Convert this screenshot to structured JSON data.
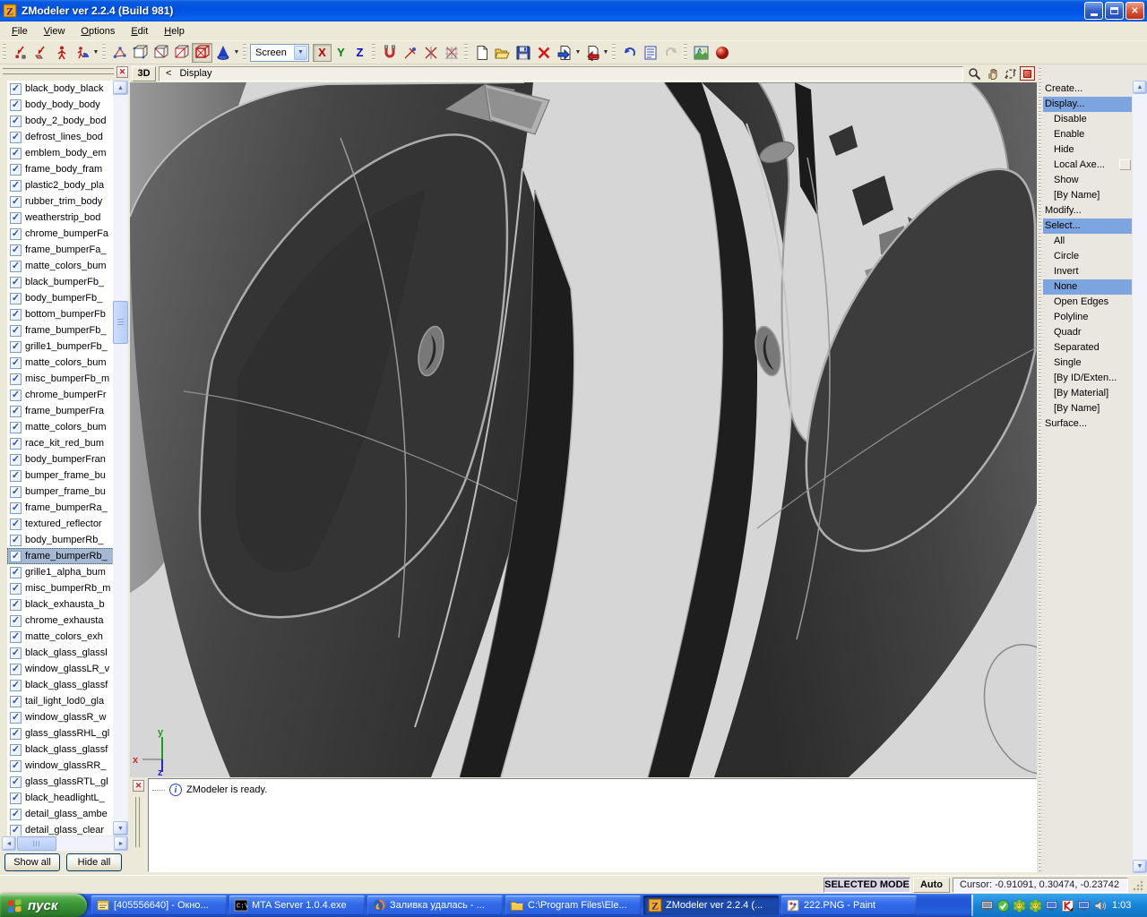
{
  "window": {
    "title": "ZModeler ver 2.2.4 (Build 981)"
  },
  "menu": [
    "File",
    "View",
    "Options",
    "Edit",
    "Help"
  ],
  "toolbar": {
    "screen_combo": "Screen",
    "axis_x": "X",
    "axis_y": "Y",
    "axis_z": "Z"
  },
  "viewport": {
    "mode": "3D",
    "back": "<",
    "path": "Display",
    "axis": {
      "x": "x",
      "y": "y",
      "z": "z"
    }
  },
  "left_panel": {
    "selected_index": 29,
    "items": [
      "black_body_black",
      "body_body_body",
      "body_2_body_bod",
      "defrost_lines_bod",
      "emblem_body_em",
      "frame_body_fram",
      "plastic2_body_pla",
      "rubber_trim_body",
      "weatherstrip_bod",
      "chrome_bumperFa",
      "frame_bumperFa_",
      "matte_colors_bum",
      "black_bumperFb_",
      "body_bumperFb_",
      "bottom_bumperFb",
      "frame_bumperFb_",
      "grille1_bumperFb_",
      "matte_colors_bum",
      "misc_bumperFb_m",
      "chrome_bumperFr",
      "frame_bumperFra",
      "matte_colors_bum",
      "race_kit_red_bum",
      "body_bumperFran",
      "bumper_frame_bu",
      "bumper_frame_bu",
      "frame_bumperRa_",
      "textured_reflector",
      "body_bumperRb_",
      "frame_bumperRb_",
      "grille1_alpha_bum",
      "misc_bumperRb_m",
      "black_exhausta_b",
      "chrome_exhausta",
      "matte_colors_exh",
      "black_glass_glassl",
      "window_glassLR_v",
      "black_glass_glassf",
      "tail_light_lod0_gla",
      "window_glassR_w",
      "glass_glassRHL_gl",
      "black_glass_glassf",
      "window_glassRR_",
      "glass_glassRTL_gl",
      "black_headlightL_",
      "detail_glass_ambe",
      "detail_glass_clear"
    ],
    "buttons": {
      "show_all": "Show all",
      "hide_all": "Hide all"
    }
  },
  "right_panel": {
    "items": [
      {
        "label": "Create...",
        "indent": 0
      },
      {
        "label": "Display...",
        "indent": 0,
        "selected": true
      },
      {
        "label": "Disable",
        "indent": 1
      },
      {
        "label": "Enable",
        "indent": 1
      },
      {
        "label": "Hide",
        "indent": 1
      },
      {
        "label": "Local Axe...",
        "indent": 1,
        "box": true
      },
      {
        "label": "Show",
        "indent": 1
      },
      {
        "label": "[By Name]",
        "indent": 1
      },
      {
        "label": "Modify...",
        "indent": 0
      },
      {
        "label": "Select...",
        "indent": 0,
        "selected": true
      },
      {
        "label": "All",
        "indent": 1
      },
      {
        "label": "Circle",
        "indent": 1
      },
      {
        "label": "Invert",
        "indent": 1
      },
      {
        "label": "None",
        "indent": 1,
        "selected": true
      },
      {
        "label": "Open Edges",
        "indent": 1
      },
      {
        "label": "Polyline",
        "indent": 1
      },
      {
        "label": "Quadr",
        "indent": 1
      },
      {
        "label": "Separated",
        "indent": 1
      },
      {
        "label": "Single",
        "indent": 1
      },
      {
        "label": "[By ID/Exten...",
        "indent": 1
      },
      {
        "label": "[By Material]",
        "indent": 1
      },
      {
        "label": "[By Name]",
        "indent": 1
      },
      {
        "label": "Surface...",
        "indent": 0
      }
    ]
  },
  "message_bar": {
    "text": "ZModeler is ready."
  },
  "status_bar": {
    "mode": "SELECTED MODE",
    "auto": "Auto",
    "cursor": "Cursor: -0.91091, 0.30474, -0.23742"
  },
  "taskbar": {
    "start": "пуск",
    "tasks": [
      {
        "label": "[405556640] - Окно...",
        "icon": "icq",
        "active": false
      },
      {
        "label": "MTA Server 1.0.4.exe",
        "icon": "console",
        "active": false
      },
      {
        "label": "Заливка удалась - ...",
        "icon": "firefox",
        "active": false
      },
      {
        "label": "C:\\Program Files\\Ele...",
        "icon": "folder",
        "active": false
      },
      {
        "label": "ZModeler ver 2.2.4 (...",
        "icon": "zmodeler",
        "active": true
      },
      {
        "label": "222.PNG - Paint",
        "icon": "paint",
        "active": false
      }
    ],
    "clock": "1:03"
  }
}
